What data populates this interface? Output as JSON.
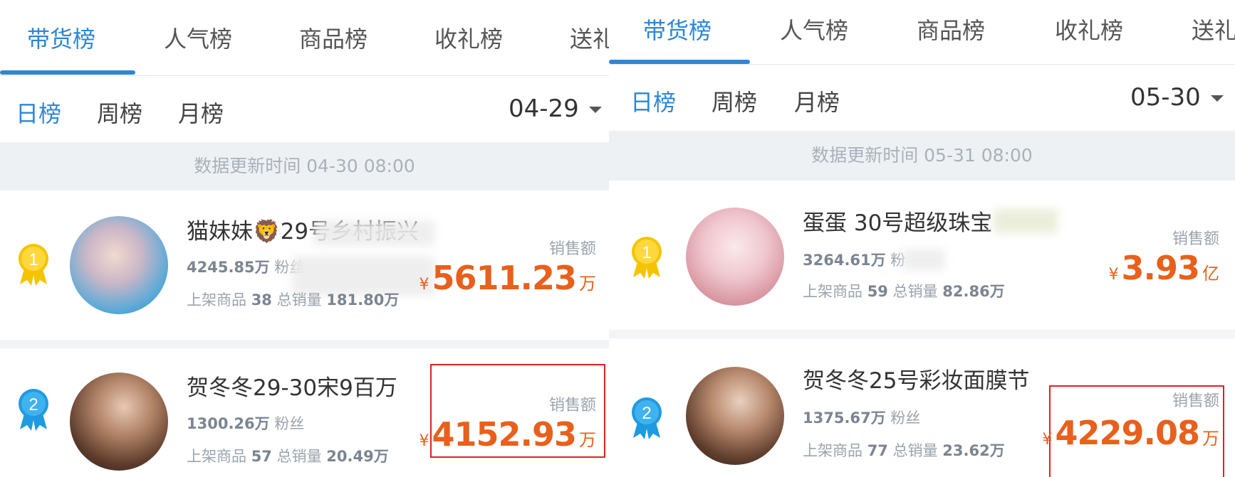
{
  "left": {
    "tabs": [
      "带货榜",
      "人气榜",
      "商品榜",
      "收礼榜",
      "送礼"
    ],
    "subtabs": [
      "日榜",
      "周榜",
      "月榜"
    ],
    "date": "04-29",
    "update_text": "数据更新时间 04-30 08:00",
    "rows": [
      {
        "rank": "1",
        "name": "猫妹妹🦁29号乡村振兴",
        "fans_value": "4245.85万",
        "fans_label": "粉丝",
        "listed_label": "上架商品",
        "listed_value": "38",
        "total_label": "总销量",
        "total_value": "181.80万",
        "sales_label": "销售额",
        "currency": "¥",
        "amount": "5611.23",
        "unit": "万"
      },
      {
        "rank": "2",
        "name": "贺冬冬29-30宋9百万",
        "fans_value": "1300.26万",
        "fans_label": "粉丝",
        "listed_label": "上架商品",
        "listed_value": "57",
        "total_label": "总销量",
        "total_value": "20.49万",
        "sales_label": "销售额",
        "currency": "¥",
        "amount": "4152.93",
        "unit": "万"
      }
    ]
  },
  "right": {
    "tabs": [
      "带货榜",
      "人气榜",
      "商品榜",
      "收礼榜",
      "送礼"
    ],
    "subtabs": [
      "日榜",
      "周榜",
      "月榜"
    ],
    "date": "05-30",
    "update_text": "数据更新时间 05-31 08:00",
    "rows": [
      {
        "rank": "1",
        "name": "蛋蛋 30号超级珠宝",
        "fans_value": "3264.61万",
        "fans_label": "粉",
        "listed_label": "上架商品",
        "listed_value": "59",
        "total_label": "总销量",
        "total_value": "82.86万",
        "sales_label": "销售额",
        "currency": "¥",
        "amount": "3.93",
        "unit": "亿"
      },
      {
        "rank": "2",
        "name": "贺冬冬25号彩妆面膜节",
        "fans_value": "1375.67万",
        "fans_label": "粉丝",
        "listed_label": "上架商品",
        "listed_value": "77",
        "total_label": "总销量",
        "total_value": "23.62万",
        "sales_label": "销售额",
        "currency": "¥",
        "amount": "4229.08",
        "unit": "万"
      }
    ]
  },
  "colors": {
    "accent": "#2d86d6",
    "sales": "#e8601c",
    "gold_medal": "#f5c400",
    "blue_medal": "#1e9be0",
    "highlight_box": "#e02020"
  },
  "icons": {
    "gold": "gold-medal-icon",
    "blue": "blue-medal-icon",
    "dropdown": "caret-down-icon"
  }
}
